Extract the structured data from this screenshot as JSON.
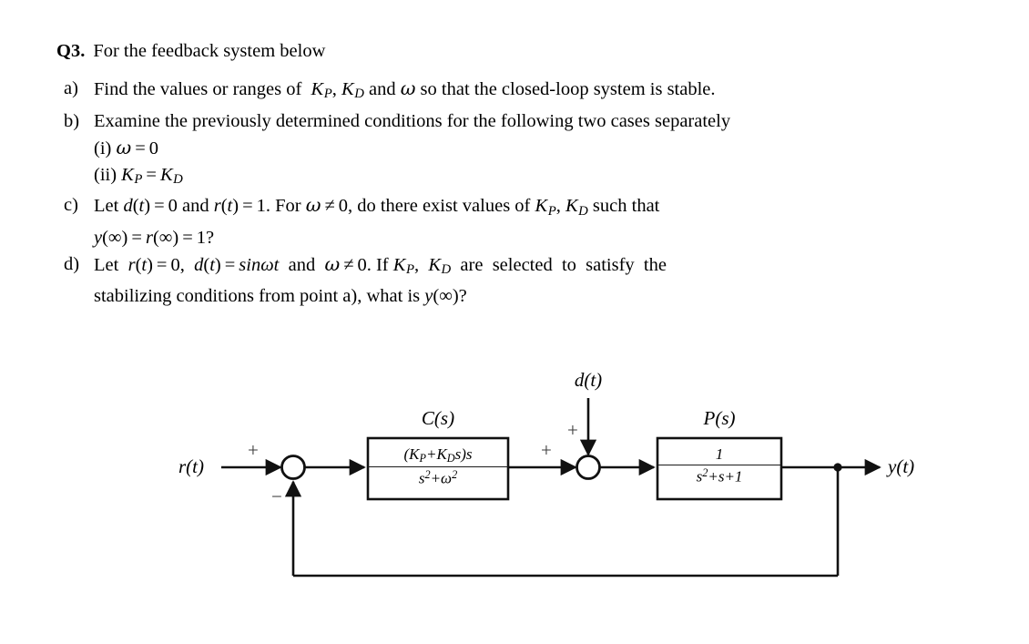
{
  "question": {
    "number": "Q3.",
    "prompt": "For the feedback system below",
    "items": [
      {
        "marker": "a)",
        "text_parts": [
          "Find the values or ranges of ",
          "K",
          "P",
          ", ",
          "K",
          "D",
          " and ",
          "ω",
          " so that the closed-loop system is stable."
        ]
      },
      {
        "marker": "b)",
        "text": "Examine the previously determined conditions for the following two cases separately",
        "subitems": [
          {
            "label": "(i)",
            "expr": "ω = 0"
          },
          {
            "label": "(ii)",
            "expr": "K_P = K_D"
          }
        ]
      },
      {
        "marker": "c)",
        "line1": "Let d(t) = 0 and r(t) = 1. For ω ≠ 0, do there exist values of K_P, K_D such that",
        "line2": "y(∞) = r(∞) = 1?"
      },
      {
        "marker": "d)",
        "line1": "Let r(t) = 0, d(t) = sinωt and ω ≠ 0. If K_P, K_D are selected to satisfy the",
        "line2": "stabilizing conditions from point a), what is y(∞)?"
      }
    ]
  },
  "diagram": {
    "input_label": "r(t)",
    "output_label": "y(t)",
    "disturbance_label": "d(t)",
    "controller": {
      "name": "C(s)",
      "numerator": "(K_P+K_D s)s",
      "denominator": "s²+ω²"
    },
    "plant": {
      "name": "P(s)",
      "numerator": "1",
      "denominator": "s²+s+1"
    },
    "signs": {
      "sum1_plus": "+",
      "sum1_minus": "−",
      "sum2_plus_left": "+",
      "sum2_plus_top": "+"
    },
    "colors": {
      "line": "#111111",
      "text": "#262626"
    }
  }
}
